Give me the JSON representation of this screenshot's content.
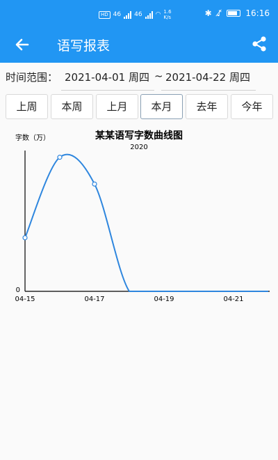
{
  "status_bar": {
    "left_badges": [
      "HD",
      "46",
      "46"
    ],
    "speed": "1.6",
    "speed_unit": "K/s",
    "time": "16:16"
  },
  "app_bar": {
    "title": "语写报表"
  },
  "range": {
    "label": "时间范围：",
    "start": "2021-04-01 周四",
    "separator": "~",
    "end": "2021-04-22 周四"
  },
  "tabs": [
    {
      "label": "上周"
    },
    {
      "label": "本周"
    },
    {
      "label": "上月"
    },
    {
      "label": "本月",
      "active": true
    },
    {
      "label": "去年"
    },
    {
      "label": "今年"
    }
  ],
  "chart_data": {
    "type": "line",
    "title": "某某语写字数曲线图",
    "subtitle": "2020",
    "ylabel": "字数（万）",
    "xlabel": "",
    "x_ticks": [
      "04-15",
      "04-17",
      "04-19",
      "04-21"
    ],
    "y_ticks": [
      "0"
    ],
    "series": [
      {
        "x": [
          "04-15",
          "04-16",
          "04-17",
          "04-18",
          "04-19",
          "04-20",
          "04-21",
          "04-22"
        ],
        "values": [
          4,
          10,
          8,
          0,
          0,
          0,
          0,
          0
        ]
      }
    ],
    "ylim": [
      0,
      10.5
    ],
    "color": "#2e86de",
    "grid": false,
    "marker_points": 3
  }
}
